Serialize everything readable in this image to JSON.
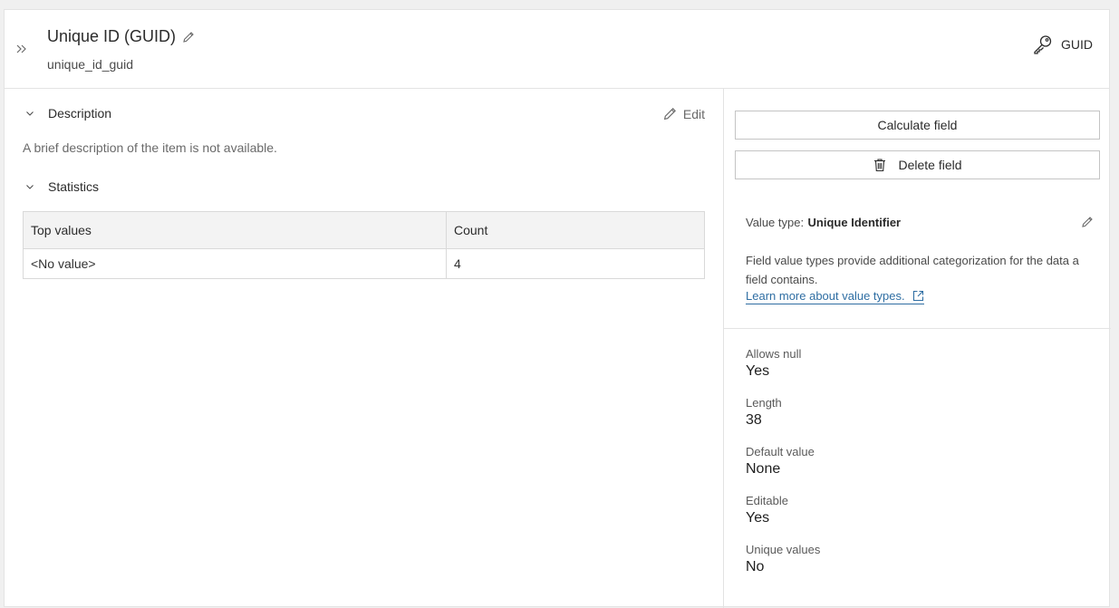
{
  "header": {
    "title": "Unique ID (GUID)",
    "subtitle": "unique_id_guid",
    "field_type_label": "GUID",
    "icons": {
      "expand": "double-chevron-right-icon",
      "title_edit": "pencil-icon",
      "type": "key-icon"
    }
  },
  "description": {
    "heading": "Description",
    "edit_label": "Edit",
    "text": "A brief description of the item is not available."
  },
  "statistics": {
    "heading": "Statistics",
    "columns": [
      "Top values",
      "Count"
    ],
    "rows": [
      [
        "<No value>",
        "4"
      ]
    ]
  },
  "actions": {
    "calculate_label": "Calculate field",
    "delete_label": "Delete field"
  },
  "value_type": {
    "prefix": "Value type:",
    "value": "Unique Identifier",
    "description": "Field value types provide additional categorization for the data a field contains.",
    "link_label": "Learn more about value types."
  },
  "properties": [
    {
      "label": "Allows null",
      "value": "Yes"
    },
    {
      "label": "Length",
      "value": "38"
    },
    {
      "label": "Default value",
      "value": "None"
    },
    {
      "label": "Editable",
      "value": "Yes"
    },
    {
      "label": "Unique values",
      "value": "No"
    }
  ],
  "colors": {
    "link": "#2f6ea3",
    "border": "#e3e3e3",
    "table_header_bg": "#f3f3f3"
  }
}
